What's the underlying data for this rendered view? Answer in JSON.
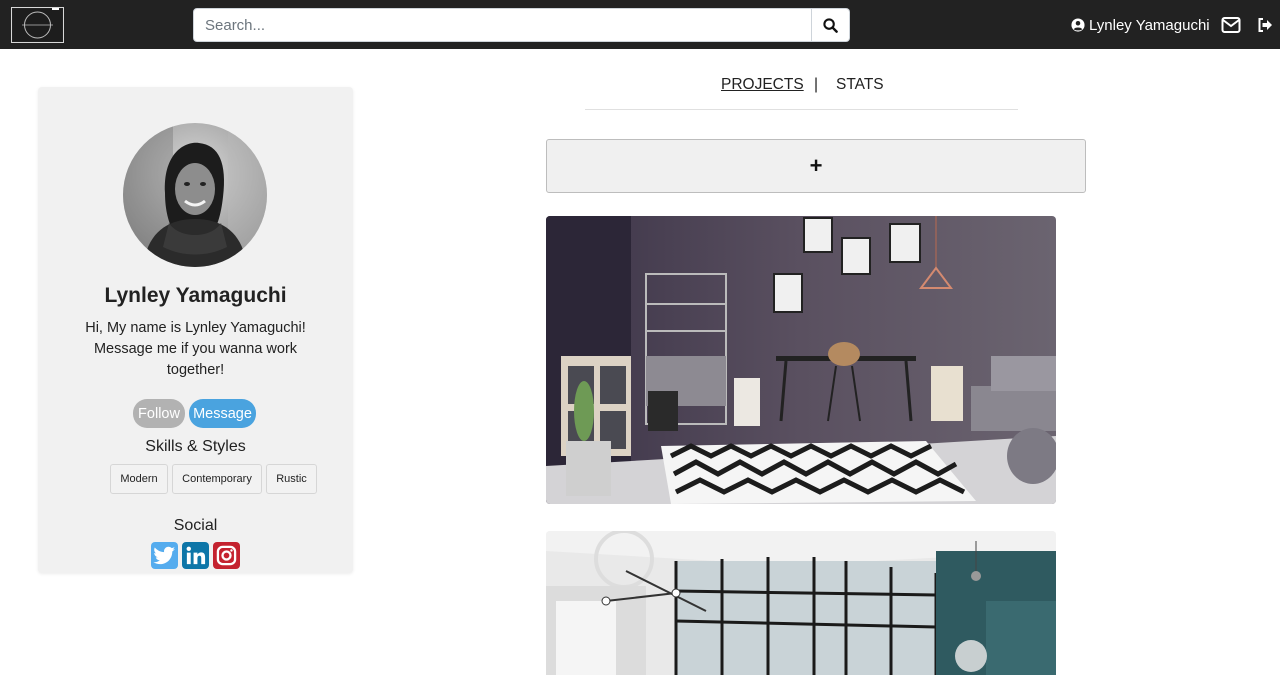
{
  "navbar": {
    "search": {
      "placeholder": "Search..."
    },
    "user_name": "Lynley Yamaguchi"
  },
  "profile": {
    "name": "Lynley Yamaguchi",
    "bio": "Hi, My name is Lynley Yamaguchi! Message me if you wanna work together!",
    "follow_label": "Follow",
    "message_label": "Message",
    "skills_heading": "Skills & Styles",
    "skills": [
      "Modern",
      "Contemporary",
      "Rustic"
    ],
    "social_heading": "Social",
    "social": [
      "twitter-icon",
      "linkedin-icon",
      "instagram-icon"
    ]
  },
  "main": {
    "tabs": [
      {
        "label": "PROJECTS",
        "active": true
      },
      {
        "label": "STATS",
        "active": false
      }
    ],
    "tab_separator": "|",
    "add_project_label": "+"
  },
  "colors": {
    "navbar_bg": "#222222",
    "card_bg": "#f1f1f1",
    "follow_bg": "#b2b2b2",
    "message_bg": "#4aa3df",
    "twitter": "#55acee",
    "linkedin": "#0e76a8",
    "instagram": "#c4222f"
  }
}
